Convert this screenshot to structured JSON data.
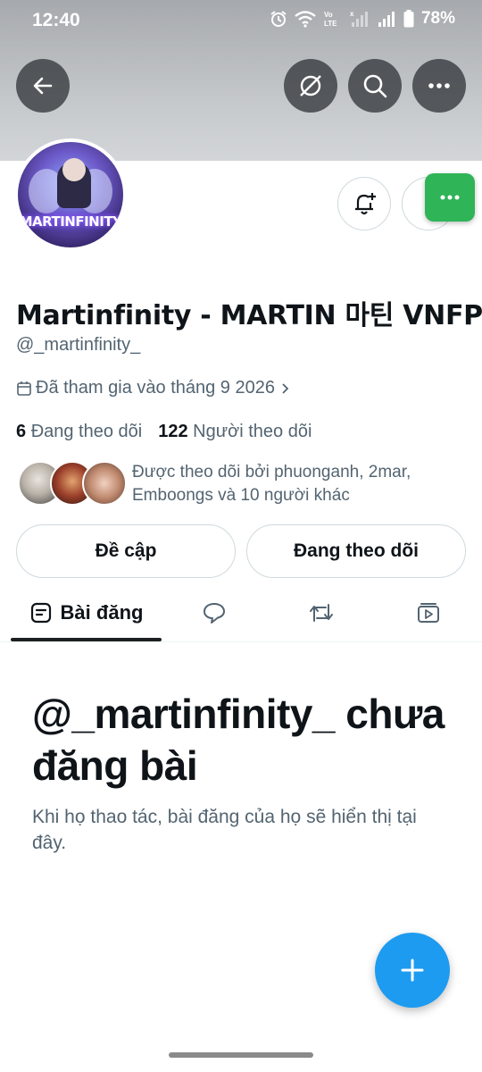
{
  "status_bar": {
    "time": "12:40",
    "battery": "78%"
  },
  "profile": {
    "display_name": "Martinfinity - MARTIN 마틴 VNFP",
    "handle": "@_martinfinity_",
    "joined": "Đã tham gia vào tháng 9 2026",
    "avatar_text": "MARTINFINITY",
    "following_count": "6",
    "following_label": "Đang theo dõi",
    "followers_count": "122",
    "followers_label": "Người theo dõi",
    "followed_by_text": "Được theo dõi bởi phuonganh, 2mar, Emboongs và 10 người khác"
  },
  "actions": {
    "mention_label": "Đề cập",
    "following_label": "Đang theo dõi"
  },
  "tabs": [
    {
      "label": "Bài đăng",
      "icon": "posts-icon",
      "active": true
    },
    {
      "label": "",
      "icon": "replies-icon",
      "active": false
    },
    {
      "label": "",
      "icon": "reposts-icon",
      "active": false
    },
    {
      "label": "",
      "icon": "media-icon",
      "active": false
    }
  ],
  "empty_state": {
    "title": "@_martinfinity_ chưa đăng bài",
    "description": "Khi họ thao tác, bài đăng của họ sẽ hiển thị tại đây."
  },
  "colors": {
    "accent": "#1d9bf0",
    "floating_chat": "#2fb457",
    "text_secondary": "#536471"
  }
}
